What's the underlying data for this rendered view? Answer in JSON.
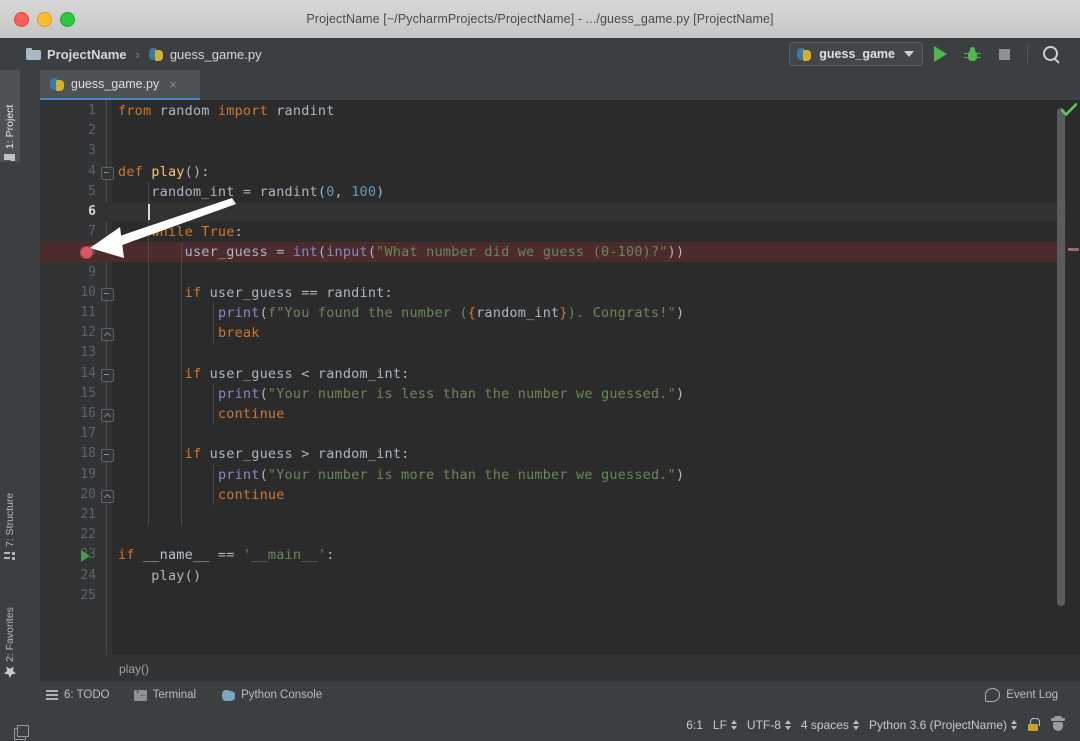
{
  "window": {
    "title": "ProjectName [~/PycharmProjects/ProjectName] - .../guess_game.py [ProjectName]",
    "traffic_colors": {
      "close": "#ff5f57",
      "minimize": "#febc2e",
      "zoom": "#28c840"
    }
  },
  "navbar": {
    "breadcrumb": {
      "project": "ProjectName",
      "separator": "›",
      "file": "guess_game.py"
    },
    "run_config": {
      "label": "guess_game"
    },
    "buttons": {
      "run": "Run",
      "debug": "Debug",
      "stop": "Stop",
      "search": "Search Everywhere"
    }
  },
  "sidebar": {
    "items": [
      {
        "label": "1: Project",
        "icon": "folder-icon",
        "active": true
      },
      {
        "label": "7: Structure",
        "icon": "structure-icon",
        "active": false
      },
      {
        "label": "2: Favorites",
        "icon": "star-icon",
        "active": false
      }
    ]
  },
  "tabs": [
    {
      "label": "guess_game.py",
      "icon": "python-file-icon",
      "close": "×",
      "active": true
    }
  ],
  "editor": {
    "caret_line": 6,
    "breakpoint_line": 8,
    "run_marker_line": 23,
    "total_lines": 25,
    "inspection_status": "ok",
    "lines": [
      {
        "n": 1,
        "tokens": [
          {
            "t": "from ",
            "c": "k"
          },
          {
            "t": "random ",
            "c": "id"
          },
          {
            "t": "import ",
            "c": "k"
          },
          {
            "t": "randint",
            "c": "id"
          }
        ],
        "indent": 0
      },
      {
        "n": 2,
        "tokens": [],
        "indent": 0
      },
      {
        "n": 3,
        "tokens": [],
        "indent": 0
      },
      {
        "n": 4,
        "tokens": [
          {
            "t": "def ",
            "c": "k"
          },
          {
            "t": "play",
            "c": "fn"
          },
          {
            "t": "():",
            "c": "id"
          }
        ],
        "indent": 0
      },
      {
        "n": 5,
        "tokens": [
          {
            "t": "    random_int = randint(",
            "c": "id"
          },
          {
            "t": "0",
            "c": "num"
          },
          {
            "t": ", ",
            "c": "id"
          },
          {
            "t": "100",
            "c": "num"
          },
          {
            "t": ")",
            "c": "id"
          }
        ],
        "indent": 1
      },
      {
        "n": 6,
        "tokens": [],
        "indent": 1
      },
      {
        "n": 7,
        "tokens": [
          {
            "t": "    ",
            "c": "id"
          },
          {
            "t": "while ",
            "c": "k"
          },
          {
            "t": "True",
            "c": "k"
          },
          {
            "t": ":",
            "c": "id"
          }
        ],
        "indent": 1
      },
      {
        "n": 8,
        "tokens": [
          {
            "t": "        user_guess = ",
            "c": "id"
          },
          {
            "t": "int",
            "c": "bi"
          },
          {
            "t": "(",
            "c": "id"
          },
          {
            "t": "input",
            "c": "bi"
          },
          {
            "t": "(",
            "c": "id"
          },
          {
            "t": "\"What number did we guess (0-100)?\"",
            "c": "st"
          },
          {
            "t": "))",
            "c": "id"
          }
        ],
        "indent": 2
      },
      {
        "n": 9,
        "tokens": [],
        "indent": 2
      },
      {
        "n": 10,
        "tokens": [
          {
            "t": "        ",
            "c": "id"
          },
          {
            "t": "if ",
            "c": "k"
          },
          {
            "t": "user_guess == randint:",
            "c": "id"
          }
        ],
        "indent": 2
      },
      {
        "n": 11,
        "tokens": [
          {
            "t": "            ",
            "c": "id"
          },
          {
            "t": "print",
            "c": "bi"
          },
          {
            "t": "(",
            "c": "id"
          },
          {
            "t": "f\"You found the number (",
            "c": "st"
          },
          {
            "t": "{",
            "c": "fb"
          },
          {
            "t": "random_int",
            "c": "id"
          },
          {
            "t": "}",
            "c": "fb"
          },
          {
            "t": "). Congrats!\"",
            "c": "st"
          },
          {
            "t": ")",
            "c": "id"
          }
        ],
        "indent": 3
      },
      {
        "n": 12,
        "tokens": [
          {
            "t": "            ",
            "c": "id"
          },
          {
            "t": "break",
            "c": "k"
          }
        ],
        "indent": 3
      },
      {
        "n": 13,
        "tokens": [],
        "indent": 2
      },
      {
        "n": 14,
        "tokens": [
          {
            "t": "        ",
            "c": "id"
          },
          {
            "t": "if ",
            "c": "k"
          },
          {
            "t": "user_guess < random_int:",
            "c": "id"
          }
        ],
        "indent": 2
      },
      {
        "n": 15,
        "tokens": [
          {
            "t": "            ",
            "c": "id"
          },
          {
            "t": "print",
            "c": "bi"
          },
          {
            "t": "(",
            "c": "id"
          },
          {
            "t": "\"Your number is less than the number we guessed.\"",
            "c": "st"
          },
          {
            "t": ")",
            "c": "id"
          }
        ],
        "indent": 3
      },
      {
        "n": 16,
        "tokens": [
          {
            "t": "            ",
            "c": "id"
          },
          {
            "t": "continue",
            "c": "k"
          }
        ],
        "indent": 3
      },
      {
        "n": 17,
        "tokens": [],
        "indent": 2
      },
      {
        "n": 18,
        "tokens": [
          {
            "t": "        ",
            "c": "id"
          },
          {
            "t": "if ",
            "c": "k"
          },
          {
            "t": "user_guess > random_int:",
            "c": "id"
          }
        ],
        "indent": 2
      },
      {
        "n": 19,
        "tokens": [
          {
            "t": "            ",
            "c": "id"
          },
          {
            "t": "print",
            "c": "bi"
          },
          {
            "t": "(",
            "c": "id"
          },
          {
            "t": "\"Your number is more than the number we guessed.\"",
            "c": "st"
          },
          {
            "t": ")",
            "c": "id"
          }
        ],
        "indent": 3
      },
      {
        "n": 20,
        "tokens": [
          {
            "t": "            ",
            "c": "id"
          },
          {
            "t": "continue",
            "c": "k"
          }
        ],
        "indent": 3
      },
      {
        "n": 21,
        "tokens": [],
        "indent": 2
      },
      {
        "n": 22,
        "tokens": [],
        "indent": 0
      },
      {
        "n": 23,
        "tokens": [
          {
            "t": "if ",
            "c": "k"
          },
          {
            "t": "__name__",
            "c": "dunder"
          },
          {
            "t": " == ",
            "c": "id"
          },
          {
            "t": "'__main__'",
            "c": "st"
          },
          {
            "t": ":",
            "c": "id"
          }
        ],
        "indent": 0
      },
      {
        "n": 24,
        "tokens": [
          {
            "t": "    play()",
            "c": "id"
          }
        ],
        "indent": 1
      },
      {
        "n": 25,
        "tokens": [],
        "indent": 0
      }
    ],
    "fold_minus_lines": [
      4,
      10,
      14,
      18
    ],
    "fold_up_lines": [
      12,
      16,
      20
    ],
    "breadcrumb": "play()"
  },
  "bottom_tools": {
    "items": [
      {
        "label": "6: TODO",
        "icon": "todo-icon"
      },
      {
        "label": "Terminal",
        "icon": "terminal-icon"
      },
      {
        "label": "Python Console",
        "icon": "python-console-icon"
      }
    ],
    "event_log": "Event Log"
  },
  "statusbar": {
    "caret_position": "6:1",
    "line_separator": "LF",
    "encoding": "UTF-8",
    "indent": "4 spaces",
    "interpreter": "Python 3.6 (ProjectName)"
  },
  "colors": {
    "editor_bg": "#2b2b2b",
    "gutter_bg": "#313335",
    "chrome_bg": "#3c3f41",
    "tab_active_underline": "#4a88c7",
    "keyword": "#cc7832",
    "string": "#6a8759",
    "number": "#6897bb",
    "builtin": "#8888c6",
    "function": "#ffc66d",
    "identifier": "#a9b7c6",
    "breakpoint": "#db5860",
    "run_green": "#4eb84e"
  }
}
